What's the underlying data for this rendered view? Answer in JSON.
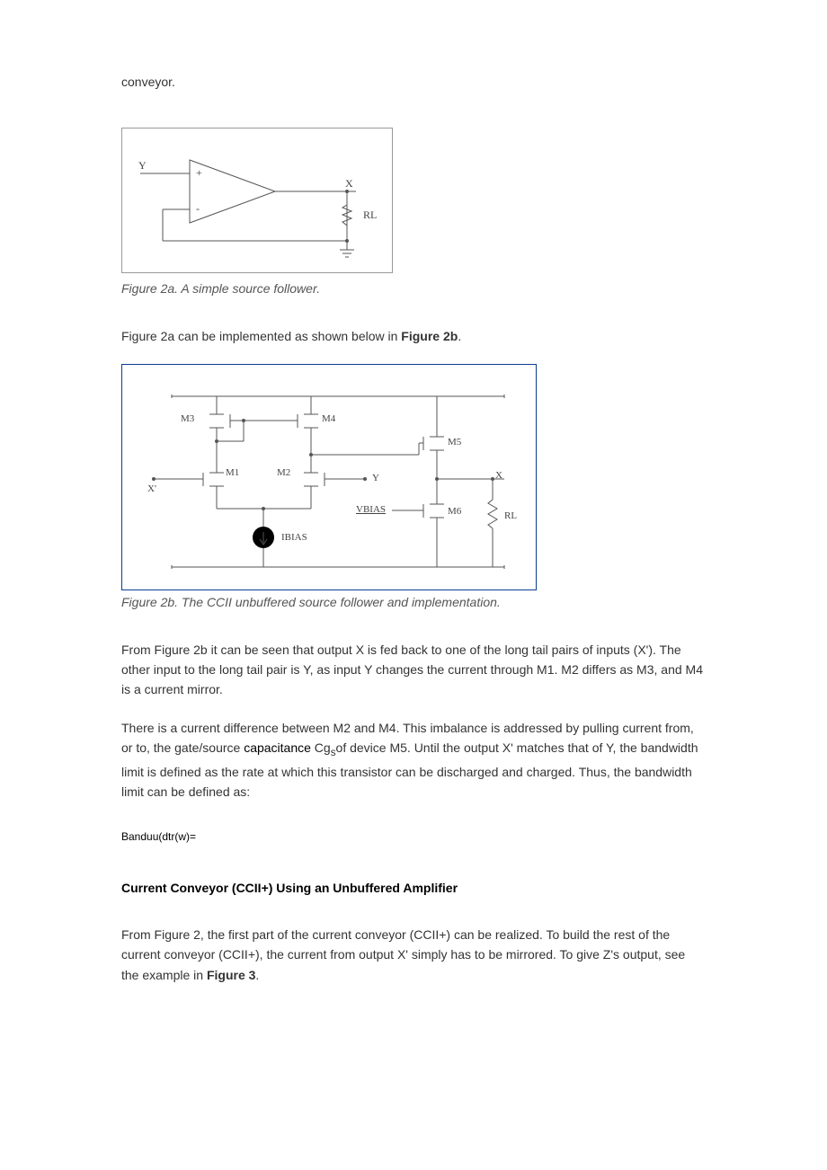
{
  "leadin": "conveyor.",
  "fig2a": {
    "caption": "Figure 2a. A simple source follower.",
    "labels": {
      "Y": "Y",
      "plus": "+",
      "minus": "-",
      "X": "X",
      "RL": "RL"
    }
  },
  "intro2b": {
    "pre": "Figure 2a can be implemented as shown below in ",
    "bold": "Figure 2b",
    "post": "."
  },
  "fig2b": {
    "caption": "Figure 2b. The CCII unbuffered source follower and implementation.",
    "labels": {
      "M1": "M1",
      "M2": "M2",
      "M3": "M3",
      "M4": "M4",
      "M5": "M5",
      "M6": "M6",
      "Xp": "X'",
      "X": "X",
      "Y": "Y",
      "VBIAS": "VBIAS",
      "IBIAS": "IBIAS",
      "RL": "RL"
    }
  },
  "para1": "From Figure 2b it can be seen that output X is fed back to one of the long tail pairs of inputs (X'). The other input to the long tail pair is Y, as input Y changes the current through M1. M2 differs as M3, and M4 is a current mirror.",
  "para2": {
    "pre": "There is a current difference between M2 and M4. This imbalance is addressed by pulling current from, or to, the gate/source ",
    "link": "capacitance",
    "mid": " Cg",
    "sub": "s",
    "post": "of device M5. Until the output X' matches that of Y, the bandwidth limit is defined as the rate at which this transistor can be discharged and charged. Thus, the bandwidth limit can be defined as:"
  },
  "formula": "Banduu(dtr(w)=",
  "heading": "Current Conveyor (CCII+) Using an Unbuffered Amplifier",
  "para3": {
    "pre": "From Figure 2, the first part of the current conveyor (CCII+) can be realized. To build the rest of the current conveyor (CCII+), the current from output X' simply has to be mirrored. To give Z's output, see the example in ",
    "bold": "Figure 3",
    "post": "."
  }
}
